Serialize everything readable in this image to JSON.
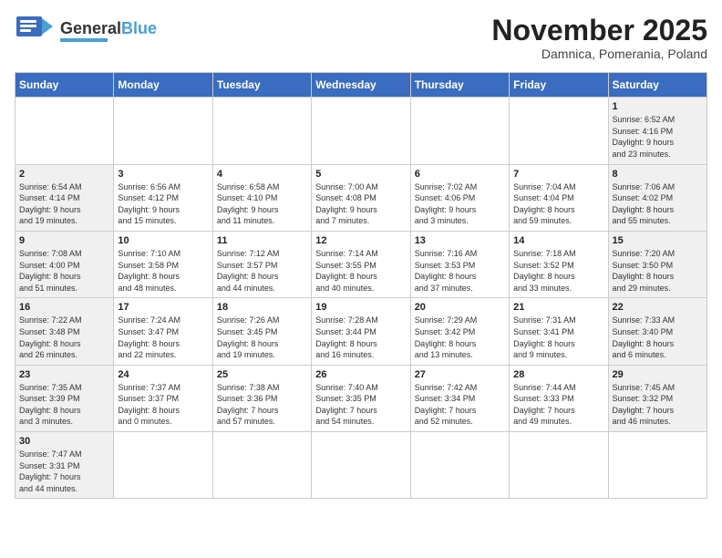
{
  "logo": {
    "text_general": "General",
    "text_blue": "Blue"
  },
  "title": "November 2025",
  "location": "Damnica, Pomerania, Poland",
  "days_of_week": [
    "Sunday",
    "Monday",
    "Tuesday",
    "Wednesday",
    "Thursday",
    "Friday",
    "Saturday"
  ],
  "weeks": [
    [
      {
        "day": "",
        "info": ""
      },
      {
        "day": "",
        "info": ""
      },
      {
        "day": "",
        "info": ""
      },
      {
        "day": "",
        "info": ""
      },
      {
        "day": "",
        "info": ""
      },
      {
        "day": "",
        "info": ""
      },
      {
        "day": "1",
        "info": "Sunrise: 6:52 AM\nSunset: 4:16 PM\nDaylight: 9 hours\nand 23 minutes."
      }
    ],
    [
      {
        "day": "2",
        "info": "Sunrise: 6:54 AM\nSunset: 4:14 PM\nDaylight: 9 hours\nand 19 minutes."
      },
      {
        "day": "3",
        "info": "Sunrise: 6:56 AM\nSunset: 4:12 PM\nDaylight: 9 hours\nand 15 minutes."
      },
      {
        "day": "4",
        "info": "Sunrise: 6:58 AM\nSunset: 4:10 PM\nDaylight: 9 hours\nand 11 minutes."
      },
      {
        "day": "5",
        "info": "Sunrise: 7:00 AM\nSunset: 4:08 PM\nDaylight: 9 hours\nand 7 minutes."
      },
      {
        "day": "6",
        "info": "Sunrise: 7:02 AM\nSunset: 4:06 PM\nDaylight: 9 hours\nand 3 minutes."
      },
      {
        "day": "7",
        "info": "Sunrise: 7:04 AM\nSunset: 4:04 PM\nDaylight: 8 hours\nand 59 minutes."
      },
      {
        "day": "8",
        "info": "Sunrise: 7:06 AM\nSunset: 4:02 PM\nDaylight: 8 hours\nand 55 minutes."
      }
    ],
    [
      {
        "day": "9",
        "info": "Sunrise: 7:08 AM\nSunset: 4:00 PM\nDaylight: 8 hours\nand 51 minutes."
      },
      {
        "day": "10",
        "info": "Sunrise: 7:10 AM\nSunset: 3:58 PM\nDaylight: 8 hours\nand 48 minutes."
      },
      {
        "day": "11",
        "info": "Sunrise: 7:12 AM\nSunset: 3:57 PM\nDaylight: 8 hours\nand 44 minutes."
      },
      {
        "day": "12",
        "info": "Sunrise: 7:14 AM\nSunset: 3:55 PM\nDaylight: 8 hours\nand 40 minutes."
      },
      {
        "day": "13",
        "info": "Sunrise: 7:16 AM\nSunset: 3:53 PM\nDaylight: 8 hours\nand 37 minutes."
      },
      {
        "day": "14",
        "info": "Sunrise: 7:18 AM\nSunset: 3:52 PM\nDaylight: 8 hours\nand 33 minutes."
      },
      {
        "day": "15",
        "info": "Sunrise: 7:20 AM\nSunset: 3:50 PM\nDaylight: 8 hours\nand 29 minutes."
      }
    ],
    [
      {
        "day": "16",
        "info": "Sunrise: 7:22 AM\nSunset: 3:48 PM\nDaylight: 8 hours\nand 26 minutes."
      },
      {
        "day": "17",
        "info": "Sunrise: 7:24 AM\nSunset: 3:47 PM\nDaylight: 8 hours\nand 22 minutes."
      },
      {
        "day": "18",
        "info": "Sunrise: 7:26 AM\nSunset: 3:45 PM\nDaylight: 8 hours\nand 19 minutes."
      },
      {
        "day": "19",
        "info": "Sunrise: 7:28 AM\nSunset: 3:44 PM\nDaylight: 8 hours\nand 16 minutes."
      },
      {
        "day": "20",
        "info": "Sunrise: 7:29 AM\nSunset: 3:42 PM\nDaylight: 8 hours\nand 13 minutes."
      },
      {
        "day": "21",
        "info": "Sunrise: 7:31 AM\nSunset: 3:41 PM\nDaylight: 8 hours\nand 9 minutes."
      },
      {
        "day": "22",
        "info": "Sunrise: 7:33 AM\nSunset: 3:40 PM\nDaylight: 8 hours\nand 6 minutes."
      }
    ],
    [
      {
        "day": "23",
        "info": "Sunrise: 7:35 AM\nSunset: 3:39 PM\nDaylight: 8 hours\nand 3 minutes."
      },
      {
        "day": "24",
        "info": "Sunrise: 7:37 AM\nSunset: 3:37 PM\nDaylight: 8 hours\nand 0 minutes."
      },
      {
        "day": "25",
        "info": "Sunrise: 7:38 AM\nSunset: 3:36 PM\nDaylight: 7 hours\nand 57 minutes."
      },
      {
        "day": "26",
        "info": "Sunrise: 7:40 AM\nSunset: 3:35 PM\nDaylight: 7 hours\nand 54 minutes."
      },
      {
        "day": "27",
        "info": "Sunrise: 7:42 AM\nSunset: 3:34 PM\nDaylight: 7 hours\nand 52 minutes."
      },
      {
        "day": "28",
        "info": "Sunrise: 7:44 AM\nSunset: 3:33 PM\nDaylight: 7 hours\nand 49 minutes."
      },
      {
        "day": "29",
        "info": "Sunrise: 7:45 AM\nSunset: 3:32 PM\nDaylight: 7 hours\nand 46 minutes."
      }
    ],
    [
      {
        "day": "30",
        "info": "Sunrise: 7:47 AM\nSunset: 3:31 PM\nDaylight: 7 hours\nand 44 minutes."
      },
      {
        "day": "",
        "info": ""
      },
      {
        "day": "",
        "info": ""
      },
      {
        "day": "",
        "info": ""
      },
      {
        "day": "",
        "info": ""
      },
      {
        "day": "",
        "info": ""
      },
      {
        "day": "",
        "info": ""
      }
    ]
  ]
}
